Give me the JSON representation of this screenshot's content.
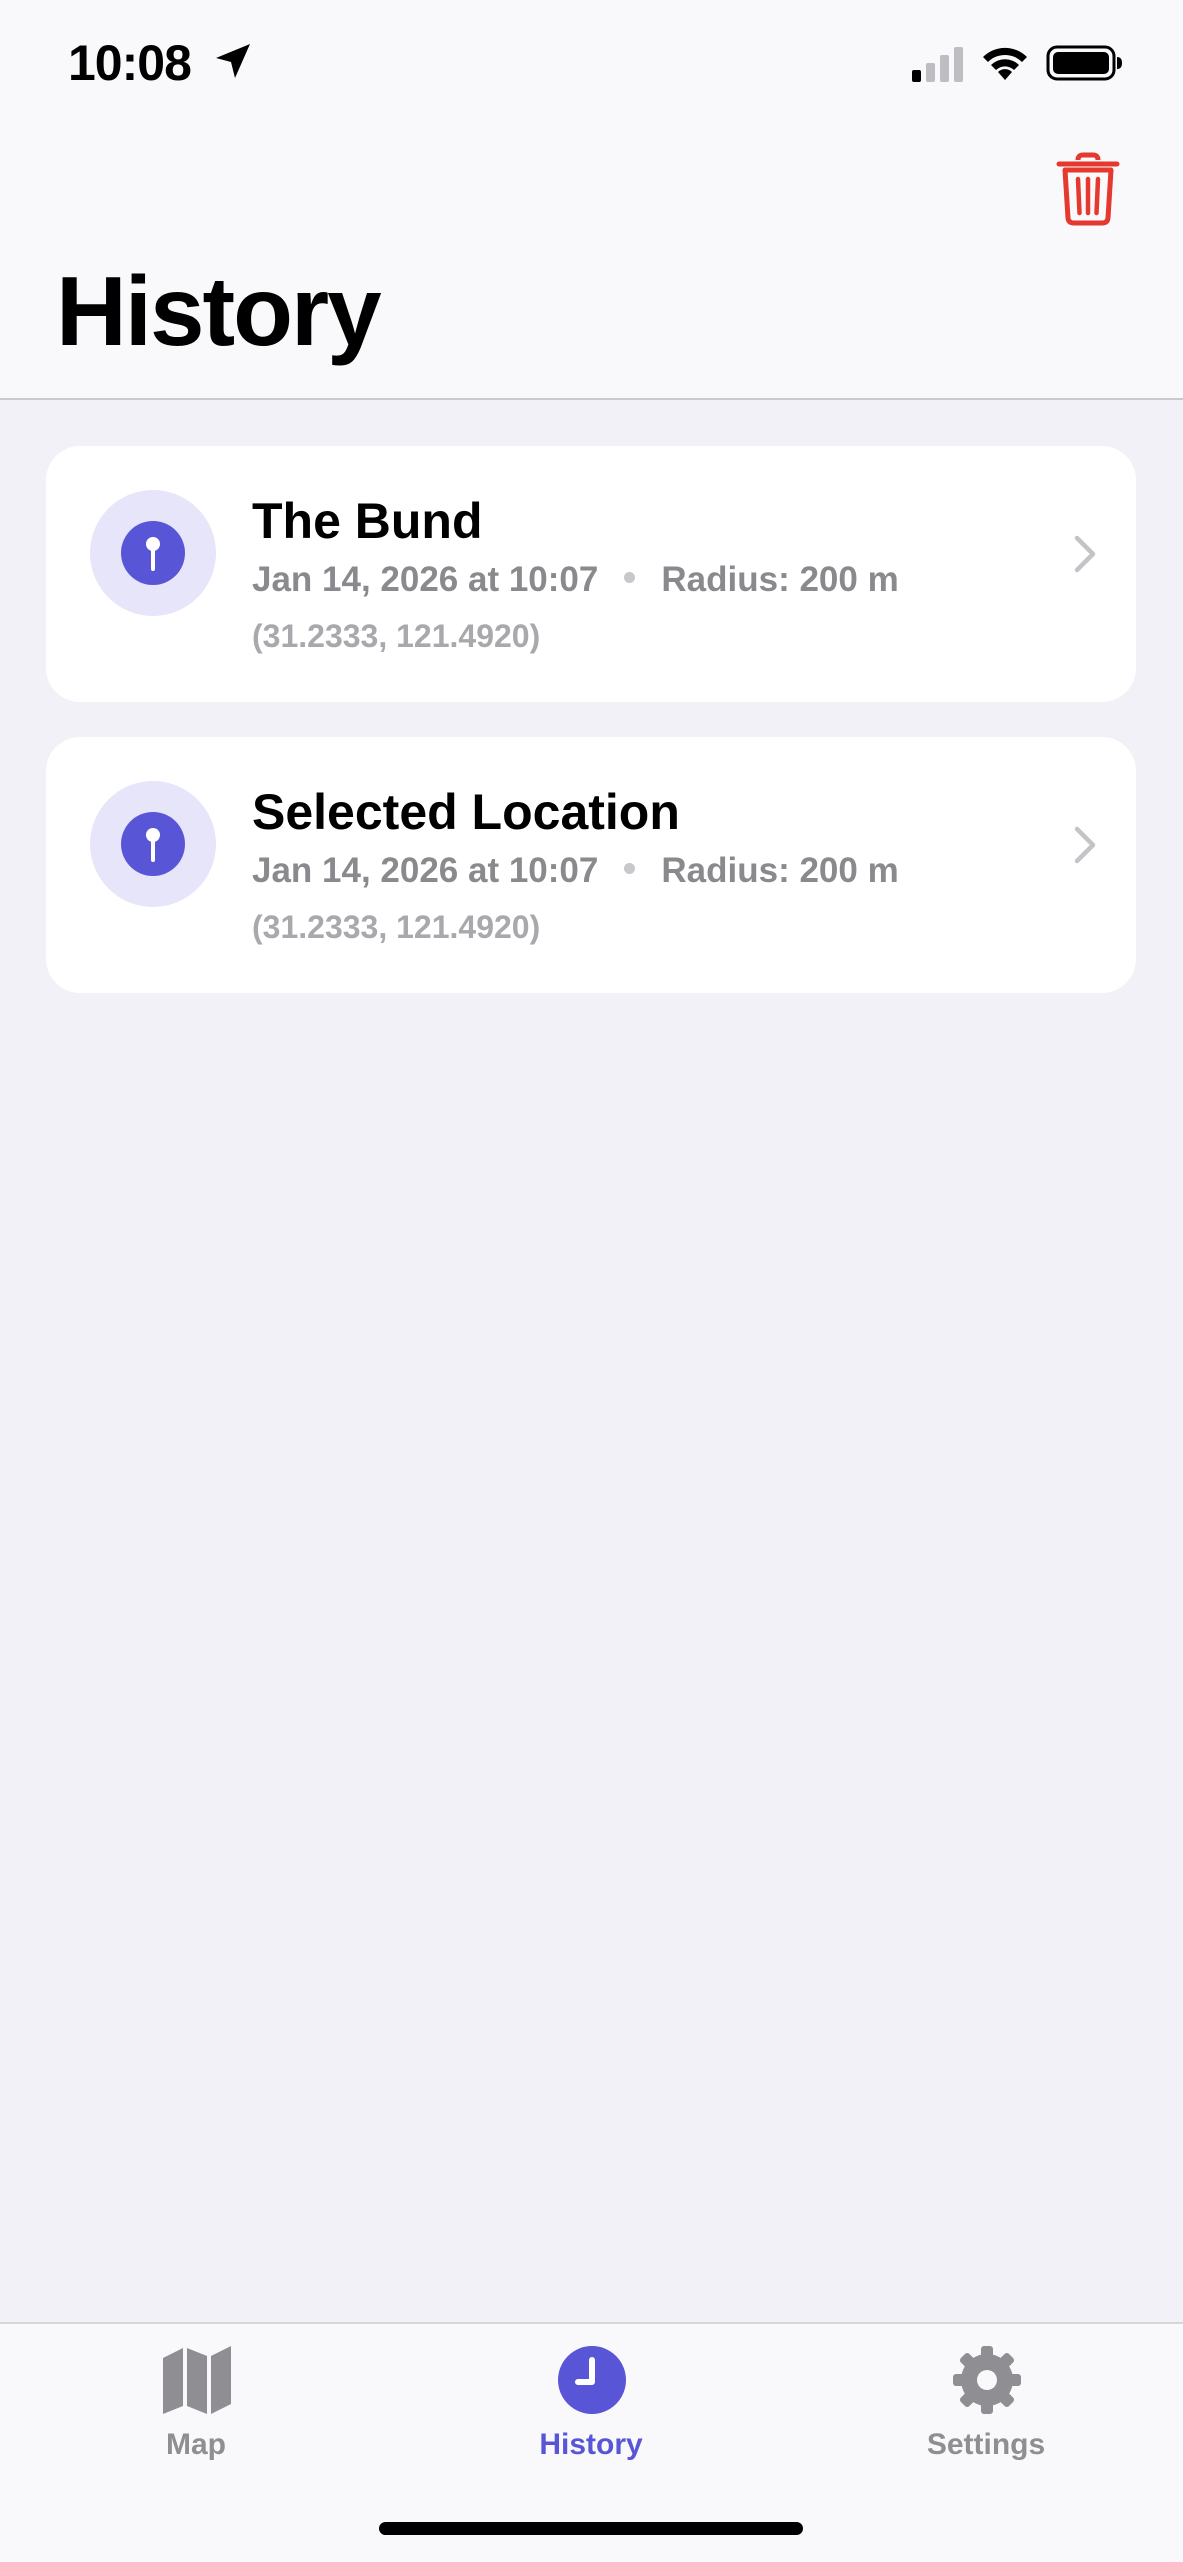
{
  "status_bar": {
    "time": "10:08",
    "icons": [
      "location-arrow-icon",
      "cellular-signal-icon",
      "wifi-icon",
      "battery-icon"
    ]
  },
  "nav": {
    "title": "History",
    "trash_icon": "trash-icon",
    "trash_color": "#e5392f"
  },
  "history": {
    "items": [
      {
        "title": "The Bund",
        "date": "Jan 14, 2026 at 10:07",
        "radius": "Radius: 200 m",
        "coords": "(31.2333, 121.4920)",
        "icon": "pin-icon"
      },
      {
        "title": "Selected Location",
        "date": "Jan 14, 2026 at 10:07",
        "radius": "Radius: 200 m",
        "coords": "(31.2333, 121.4920)",
        "icon": "pin-icon"
      }
    ]
  },
  "tab_bar": {
    "tabs": [
      {
        "label": "Map",
        "icon": "map-icon",
        "active": false
      },
      {
        "label": "History",
        "icon": "clock-icon",
        "active": true
      },
      {
        "label": "Settings",
        "icon": "gear-icon",
        "active": false
      }
    ]
  },
  "colors": {
    "accent": "#5856d6",
    "accent_light": "#e6e5f9",
    "destructive": "#e5392f",
    "inactive": "#8e8e93"
  }
}
